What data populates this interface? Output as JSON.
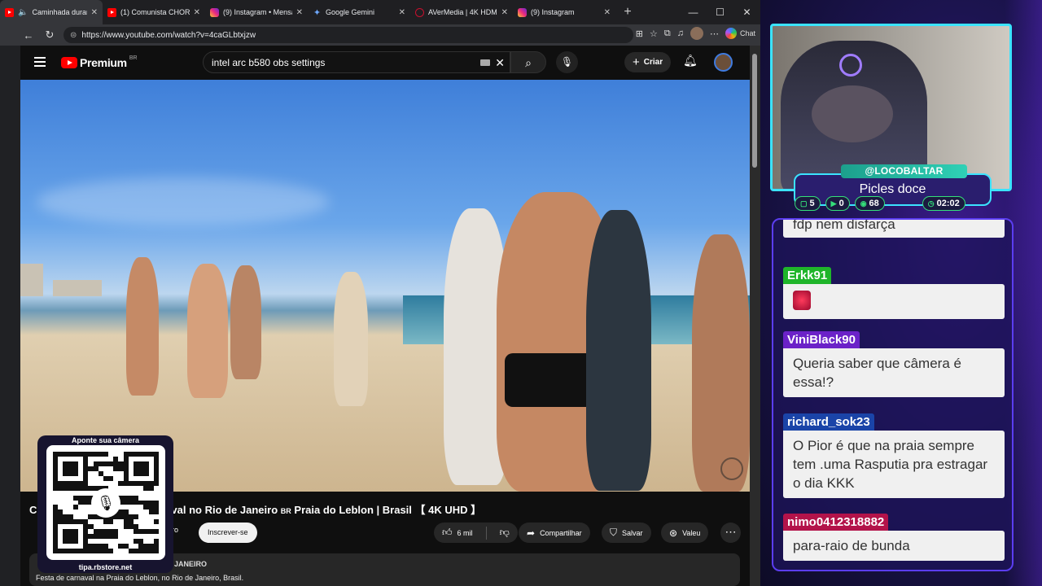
{
  "browser": {
    "tabs": [
      {
        "icon": "youtube-icon",
        "title": "Caminhada duran",
        "active": true,
        "muted": true
      },
      {
        "icon": "youtube-icon",
        "title": "(1) Comunista CHORA"
      },
      {
        "icon": "instagram-icon",
        "title": "(9) Instagram • Mensa"
      },
      {
        "icon": "gemini-icon",
        "title": "Google Gemini"
      },
      {
        "icon": "avermedia-icon",
        "title": "AVerMedia | 4K HDMI"
      },
      {
        "icon": "instagram-icon",
        "title": "(9) Instagram"
      }
    ],
    "url": "https://www.youtube.com/watch?v=4caGLbtxjzw",
    "chat_label": "Chat"
  },
  "youtube": {
    "logo_text": "Premium",
    "country_code": "BR",
    "search_query": "intel arc b580 obs settings",
    "create_label": "Criar",
    "video_title_start": "C",
    "video_title_main": "val no Rio de Janeiro",
    "video_title_flag": "BR",
    "video_title_end": "Praia do Leblon | Brasil 【 4K UHD 】",
    "member_label": "bro",
    "subscribe_label": "Inscrever-se",
    "likes": "6 mil",
    "share_label": "Compartilhar",
    "save_label": "Salvar",
    "thanks_label": "Valeu",
    "desc_meta": "DE JANEIRO",
    "desc_text": "Festa de carnaval na Praia do Leblon, no Rio de Janeiro, Brasil."
  },
  "qr": {
    "top_text": "Aponte sua câmera",
    "bottom_text": "tipa.rbstore.net"
  },
  "stream": {
    "username": "@LOCOBALTAR",
    "title": "Picles doce",
    "stats": {
      "chat": "5",
      "youtube": "0",
      "followers": "68",
      "time": "02:02"
    }
  },
  "chat": [
    {
      "user": "",
      "text": "fdp nem disfarça",
      "color": "#1fb52a"
    },
    {
      "user": "Erkk91",
      "text": "",
      "emote": "red-gem-emote",
      "color": "#1fb52a"
    },
    {
      "user": "ViniBlack90",
      "text": "Queria saber que câmera é essa!?",
      "color": "#6b22c8"
    },
    {
      "user": "richard_sok23",
      "text": "O Pior é que na praia sempre tem .uma Rasputia pra estragar o dia KKK",
      "color": "#1a44a8"
    },
    {
      "user": "nimo0412318882",
      "text": "para-raio de bunda",
      "color": "#b3134a"
    }
  ]
}
